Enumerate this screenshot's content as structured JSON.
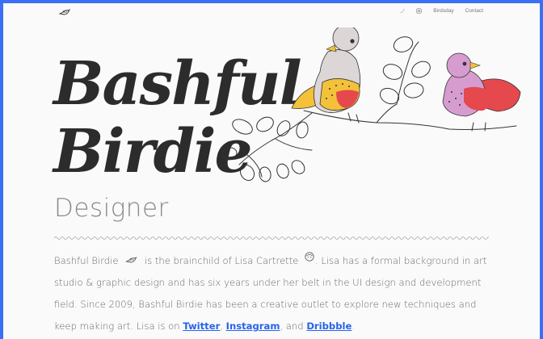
{
  "nav": {
    "links": [
      {
        "label": "Birdsday"
      },
      {
        "label": "Contact"
      }
    ],
    "icons": [
      "twitter-icon",
      "instagram-icon"
    ]
  },
  "hero": {
    "title_line1": "Bashful",
    "title_line2": "Birdie",
    "subtitle": "Designer"
  },
  "bio": {
    "part1": "Bashful Birdie",
    "part2": "is the brainchild of Lisa Cartrette",
    "part3": ". Lisa has a formal background in art studio & graphic design and has six years under her belt in the UI design and development field. Since 2009, Bashful Birdie has been a creative outlet to explore new techniques and keep making art. Lisa is on",
    "link_twitter": "Twitter",
    "sep1": ",",
    "link_instagram": "Instagram",
    "sep2": ", and",
    "link_dribbble": "Dribbble",
    "end": "."
  },
  "colors": {
    "frame_border": "#3b6ff5",
    "link": "#2563eb",
    "title": "#2c2c2c",
    "bird1_body": "#ddd6d6",
    "bird1_belly": "#f3c13a",
    "bird2_body": "#d79ccf",
    "bird2_wing": "#e5484d"
  }
}
